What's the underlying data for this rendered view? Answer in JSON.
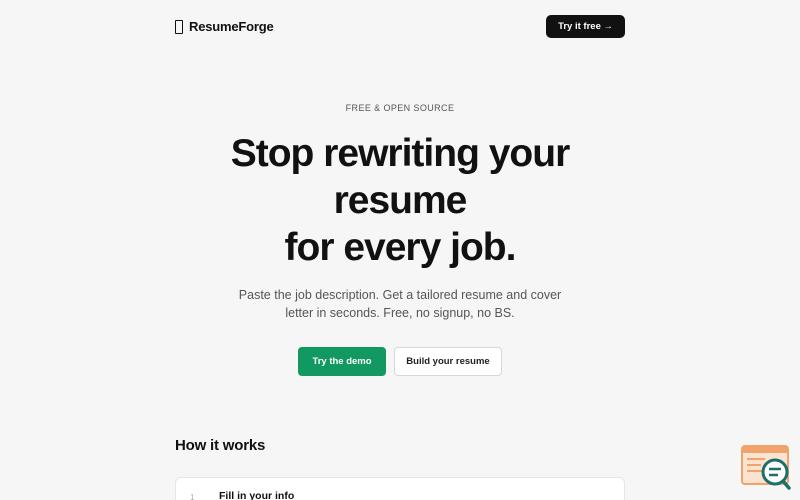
{
  "nav": {
    "brand_icon": "page-icon",
    "brand_name": "ResumeForge",
    "cta_label": "Try it free →"
  },
  "hero": {
    "eyebrow": "FREE & OPEN SOURCE",
    "headline": [
      "Stop rewriting your",
      "resume",
      "for every job."
    ],
    "subtitle": [
      "Paste the job description. Get a tailored resume and cover",
      "letter in seconds. Free, no signup, no BS."
    ],
    "primary_button": "Try the demo",
    "secondary_button": "Build your resume"
  },
  "how_it_works": {
    "title": "How it works",
    "steps": [
      {
        "number": "1",
        "title": "Fill in your info"
      }
    ]
  },
  "widget": {
    "icon": "chat-search-widget-icon"
  },
  "colors": {
    "background": "#f6f6f6",
    "primary": "#129962",
    "dark": "#111111",
    "widget_orange": "#f0a36b",
    "widget_teal": "#1c6f6a"
  }
}
